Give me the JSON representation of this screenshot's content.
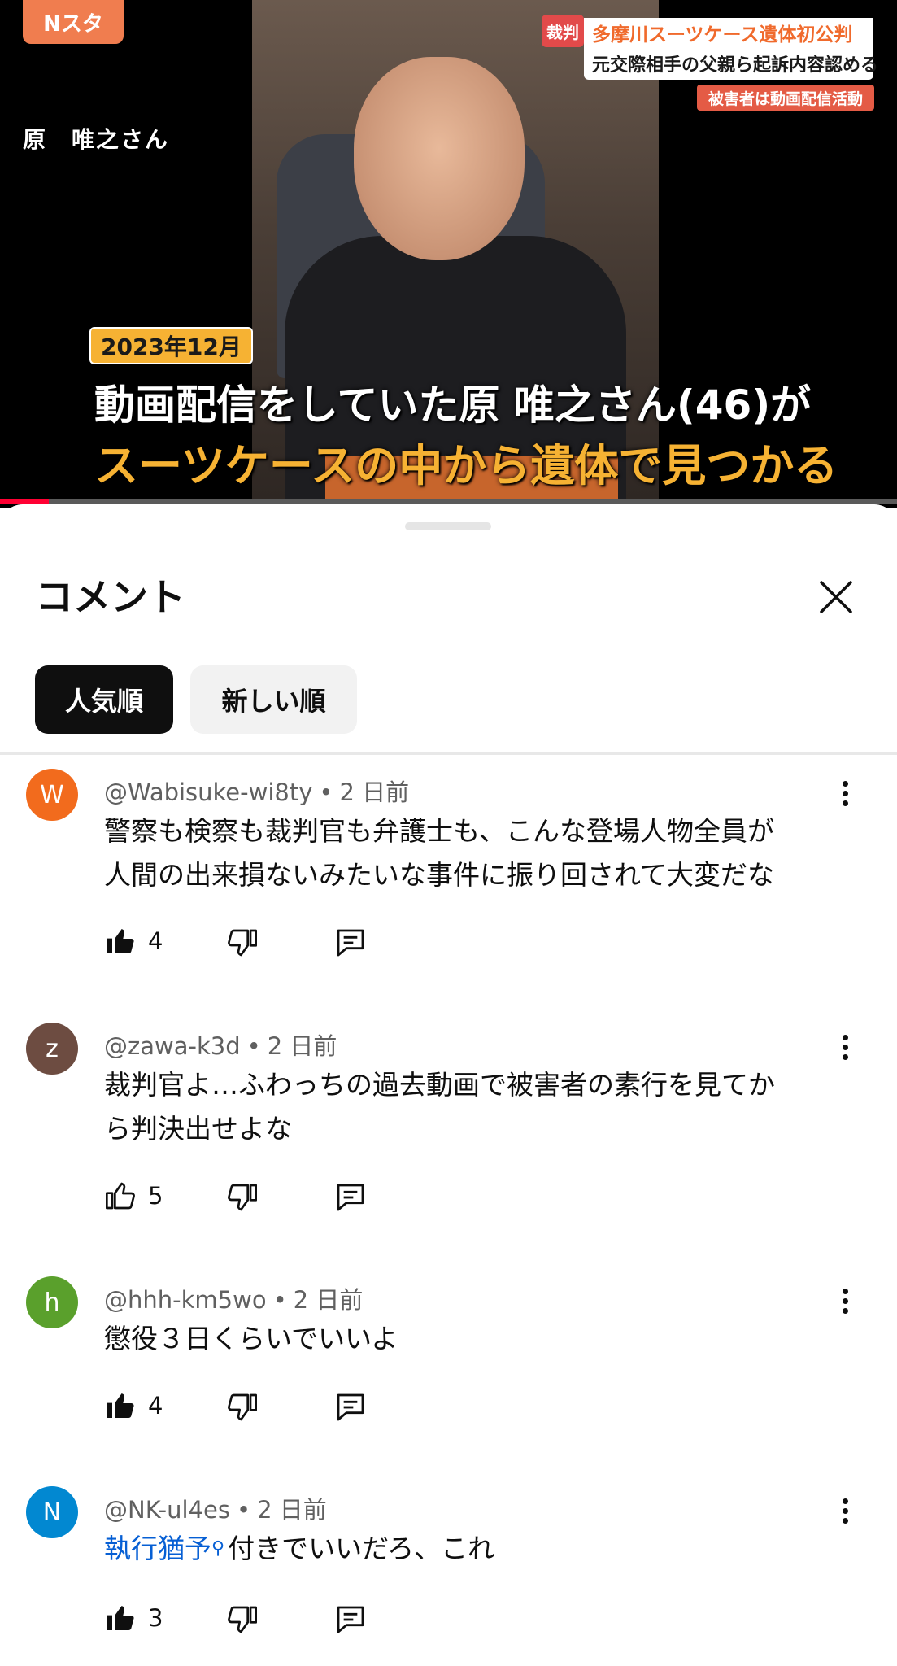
{
  "video": {
    "brand": "Nスタ",
    "person_name": "原　唯之さん",
    "ticker": {
      "tag": "裁判",
      "line1": "多摩川スーツケース遺体初公判",
      "line2": "元交際相手の父親ら起訴内容認める",
      "line3": "被害者は動画配信活動"
    },
    "date_badge": "2023年12月",
    "caption_line1": "動画配信をしていた原 唯之さん(46)が",
    "caption_line2": "スーツケースの中から遺体で見つかる",
    "progress_fraction": 0.054
  },
  "comments_panel": {
    "title": "コメント",
    "close_icon": "close-icon",
    "sort_chips": [
      {
        "label": "人気順",
        "selected": true
      },
      {
        "label": "新しい順",
        "selected": false
      }
    ],
    "comments": [
      {
        "avatar_letter": "W",
        "avatar_color": "#f26b1d",
        "author": "@Wabisuke-wi8ty",
        "separator": "•",
        "time": "2 日前",
        "text_line1": "警察も検察も裁判官も弁護士も、こんな登場人物全員が",
        "text_line2": "人間の出来損ないみたいな事件に振り回されて大変だな",
        "likes": "4",
        "liked": true
      },
      {
        "avatar_letter": "z",
        "avatar_color": "#6d4c41",
        "author": "@zawa-k3d",
        "separator": "•",
        "time": "2 日前",
        "text_line1": "裁判官よ…ふわっちの過去動画で被害者の素行を見てか",
        "text_line2": "ら判決出せよな",
        "likes": "5",
        "liked": false
      },
      {
        "avatar_letter": "h",
        "avatar_color": "#5aa02c",
        "author": "@hhh-km5wo",
        "separator": "•",
        "time": "2 日前",
        "text_line1": "懲役３日くらいでいいよ",
        "likes": "4",
        "liked": true
      },
      {
        "avatar_letter": "N",
        "avatar_color": "#0288d1",
        "author": "@NK-ul4es",
        "separator": "•",
        "time": "2 日前",
        "text_link": "執行猶予",
        "text_rest": "付きでいいだろ、これ",
        "likes": "3",
        "liked": true
      }
    ]
  },
  "icons": {
    "like": "thumbs-up-icon",
    "dislike": "thumbs-down-icon",
    "reply": "reply-icon",
    "more": "more-vertical-icon",
    "search": "search-icon"
  }
}
